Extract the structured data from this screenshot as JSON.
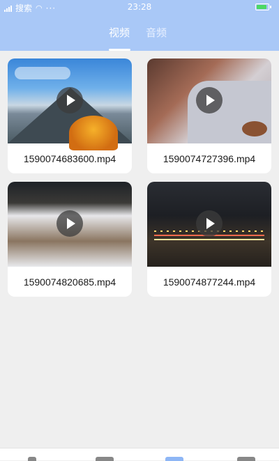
{
  "status_bar": {
    "time": "23:28",
    "carrier": "搜索",
    "icons": [
      "signal-icon",
      "wifi-icon",
      "more-icon",
      "battery-icon"
    ]
  },
  "tabs": [
    {
      "label": "视频",
      "active": true
    },
    {
      "label": "音频",
      "active": false
    }
  ],
  "colors": {
    "header_bg": "#a9c8f7",
    "page_bg": "#efefef",
    "card_bg": "#ffffff",
    "active_nav": "#8eb6f5"
  },
  "videos": [
    {
      "filename": "1590074683600.mp4",
      "thumbnail": "mountain-autumn-tree"
    },
    {
      "filename": "1590074727396.mp4",
      "thumbnail": "person-with-guitar"
    },
    {
      "filename": "1590074820685.mp4",
      "thumbnail": "snowy-field"
    },
    {
      "filename": "1590074877244.mp4",
      "thumbnail": "night-city-traffic"
    }
  ],
  "bottom_nav": [
    "nav-item-1",
    "nav-item-2",
    "nav-item-files",
    "nav-item-4"
  ]
}
